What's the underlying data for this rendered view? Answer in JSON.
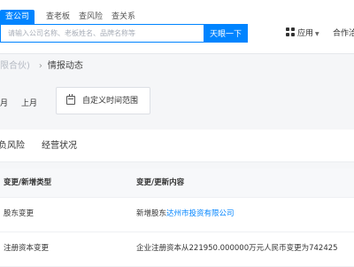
{
  "header": {
    "tabs": [
      {
        "label": "查公司",
        "active": true
      },
      {
        "label": "查老板",
        "active": false
      },
      {
        "label": "查风险",
        "active": false
      },
      {
        "label": "查关系",
        "active": false
      }
    ],
    "search": {
      "placeholder": "请输入公司名称、老板姓名、品牌名称等",
      "button_label": "天眼一下"
    },
    "apps_label": "应用",
    "coop_label": "合作洽"
  },
  "breadcrumb": {
    "prev": "限合伙)",
    "current": "情报动态"
  },
  "filters": {
    "items": [
      "月",
      "上月"
    ],
    "custom_range": "自定义时间范围"
  },
  "section_tabs": [
    "负风险",
    "经营状况"
  ],
  "table": {
    "headers": [
      "变更/新增类型",
      "变更/更新内容"
    ],
    "rows": [
      {
        "type": "股东变更",
        "content_prefix": "新增股东",
        "content_link": "达州市投资有限公司",
        "content_suffix": ""
      },
      {
        "type": "注册资本变更",
        "content_prefix": "企业注册资本从221950.000000万元人民币变更为742425",
        "content_link": "",
        "content_suffix": ""
      }
    ]
  },
  "colors": {
    "accent": "#0084ff",
    "link": "#0084ff"
  }
}
